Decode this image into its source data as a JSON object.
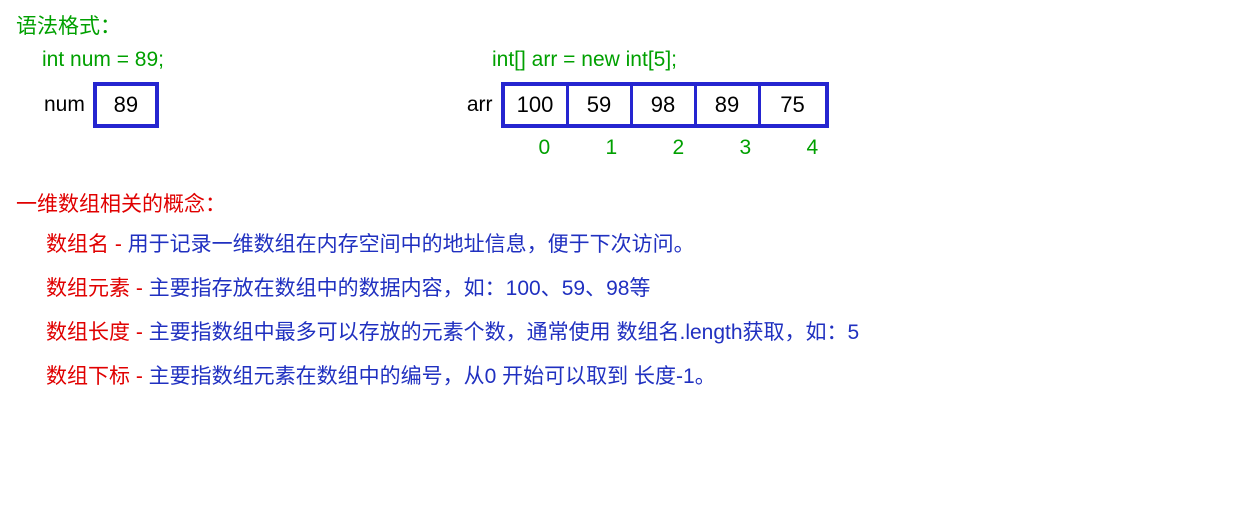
{
  "title": "语法格式：",
  "syntax": {
    "varDecl": "int num = 89;",
    "arrDecl": "int[] arr = new int[5];"
  },
  "diagram": {
    "varLabel": "num",
    "varValue": "89",
    "arrLabel": "arr",
    "arrValues": [
      "100",
      "59",
      "98",
      "89",
      "75"
    ],
    "arrIndices": [
      "0",
      "1",
      "2",
      "3",
      "4"
    ]
  },
  "conceptsTitle": "一维数组相关的概念：",
  "concepts": [
    {
      "term": "数组名",
      "dash": " - ",
      "desc": "用于记录一维数组在内存空间中的地址信息，便于下次访问。"
    },
    {
      "term": "数组元素",
      "dash": " - ",
      "desc": "主要指存放在数组中的数据内容，如：100、59、98等"
    },
    {
      "term": "数组长度",
      "dash": " - ",
      "desc": "主要指数组中最多可以存放的元素个数，通常使用 数组名.length获取，如：5"
    },
    {
      "term": "数组下标",
      "dash": " - ",
      "desc": "主要指数组元素在数组中的编号，从0 开始可以取到 长度-1。"
    }
  ]
}
